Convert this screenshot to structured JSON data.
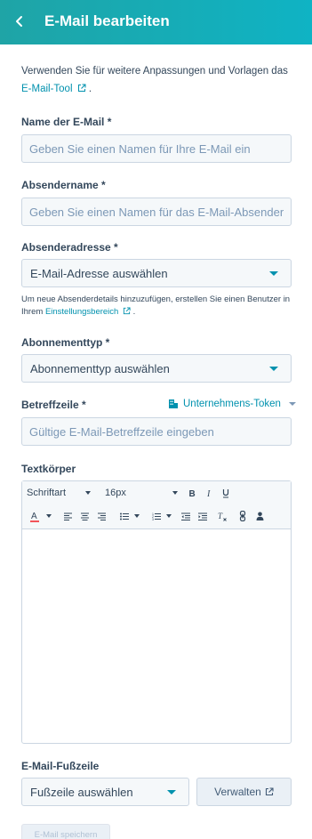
{
  "header": {
    "title": "E-Mail bearbeiten",
    "back_icon": "chevron-left-icon"
  },
  "intro": {
    "text": "Verwenden Sie für weitere Anpassungen und Vorlagen das ",
    "link": "E-Mail-Tool",
    "suffix": "."
  },
  "fields": {
    "name": {
      "label": "Name der E-Mail *",
      "placeholder": "Geben Sie einen Namen für Ihre E-Mail ein",
      "value": ""
    },
    "sender_name": {
      "label": "Absendername *",
      "placeholder": "Geben Sie einen Namen für das E-Mail-Absender",
      "value": ""
    },
    "sender_address": {
      "label": "Absenderadresse *",
      "selected": "E-Mail-Adresse auswählen"
    },
    "sender_hint": {
      "text": "Um neue Absenderdetails hinzuzufügen, erstellen Sie einen Benutzer in Ihrem ",
      "link": "Einstellungsbereich",
      "suffix": "."
    },
    "subscription": {
      "label": "Abonnementtyp *",
      "selected": "Abonnementtyp auswählen"
    },
    "subject": {
      "label": "Betreffzeile *",
      "placeholder": "Gültige E-Mail-Betreffzeile eingeben",
      "value": "",
      "token_link": "Unternehmens-Token"
    },
    "body": {
      "label": "Textkörper",
      "font_family": "Schriftart",
      "font_size": "16px"
    },
    "footer": {
      "label": "E-Mail-Fußzeile",
      "selected": "Fußzeile auswählen",
      "manage_label": "Verwalten"
    }
  },
  "actions": {
    "save_label": "E-Mail speichern"
  },
  "colors": {
    "header_start": "#1fa4a6",
    "header_end": "#0fb3c4",
    "link": "#0091ae",
    "text": "#33475b"
  }
}
